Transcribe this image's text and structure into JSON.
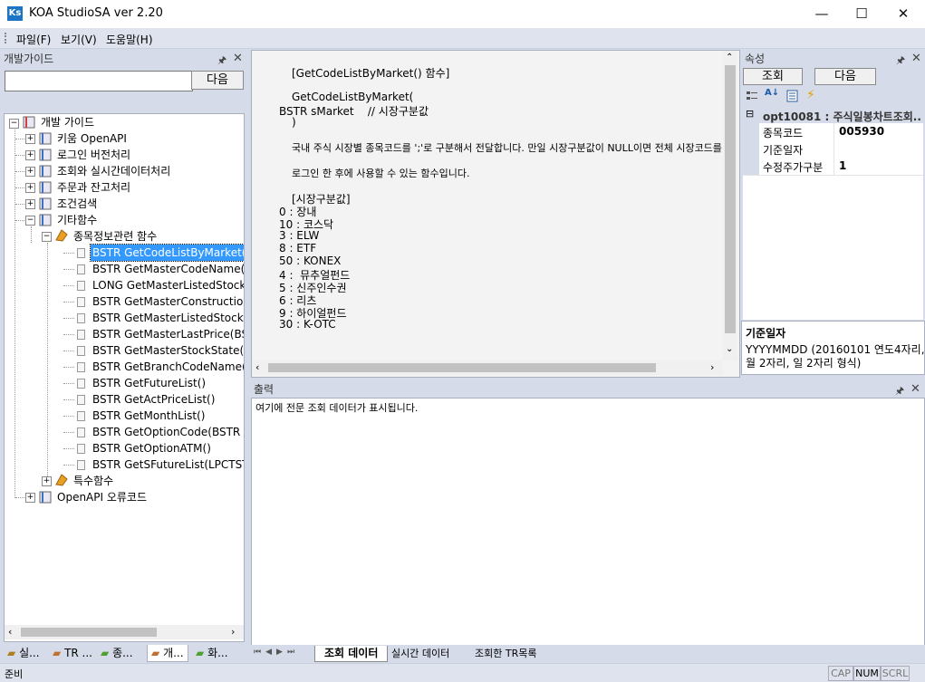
{
  "window": {
    "title": "KOA StudioSA ver 2.20",
    "icon_text": "Ks",
    "minimize": "—",
    "maximize": "☐",
    "close": "✕"
  },
  "menu": [
    "파일(F)",
    "보기(V)",
    "도움말(H)"
  ],
  "left_panel": {
    "title": "개발가이드",
    "search_placeholder": "",
    "next_button": "다음",
    "tree": {
      "root": "개발 가이드",
      "items": [
        "키움 OpenAPI",
        "로그인 버전처리",
        "조회와 실시간데이터처리",
        "주문과 잔고처리",
        "조건검색",
        "기타함수"
      ],
      "subgroup": "종목정보관련 함수",
      "functions": [
        "BSTR GetCodeListByMarket(BSTR",
        "BSTR GetMasterCodeName(BST",
        "LONG GetMasterListedStockCn",
        "BSTR GetMasterConstruction(B",
        "BSTR GetMasterListedStockDat",
        "BSTR GetMasterLastPrice(BSTR",
        "BSTR GetMasterStockState(BST",
        "BSTR GetBranchCodeName()",
        "BSTR GetFutureList()",
        "BSTR GetActPriceList()",
        "BSTR GetMonthList()",
        "BSTR GetOptionCode(BSTR str",
        "BSTR GetOptionATM()",
        "BSTR GetSFutureList(LPCTSTR s"
      ],
      "special": "특수함수",
      "errors": "OpenAPI 오류코드"
    },
    "tabs": [
      "실...",
      "TR ...",
      "종...",
      "개...",
      "화..."
    ]
  },
  "doc": {
    "heading": "[GetCodeListByMarket() 함수]",
    "sig1": "GetCodeListByMarket(",
    "sig2": "BSTR sMarket    // 시장구분값",
    "sig3": ")",
    "desc1": "국내 주식 시장별 종목코드를 ';'로 구분해서 전달합니다. 만일 시장구분값이 NULL이면 전체 시장코드를",
    "desc2": "로그인 한 후에 사용할 수 있는 함수입니다.",
    "list_title": "[시장구분값]",
    "list": [
      "0 : 장내",
      "10 : 코스닥",
      "3 : ELW",
      "8 : ETF",
      "50 : KONEX",
      "4 :  뮤추얼펀드",
      "5 : 신주인수권",
      "6 : 리츠",
      "9 : 하이얼펀드",
      "30 : K-OTC"
    ]
  },
  "props": {
    "title": "속성",
    "query_button": "조회",
    "next_button": "다음",
    "group": "opt10081 : 주식일봉차트조회...",
    "rows": [
      {
        "label": "종목코드",
        "value": "005930"
      },
      {
        "label": "기준일자",
        "value": ""
      },
      {
        "label": "수정주가구분",
        "value": "1"
      }
    ],
    "help_title": "기준일자",
    "help_text1": "YYYYMMDD (20160101 연도4자리,",
    "help_text2": "월 2자리, 일 2자리 형식)"
  },
  "output": {
    "title": "출력",
    "text": "여기에 전문 조회 데이터가 표시됩니다.",
    "tabs": [
      "조회 데이터",
      "실시간 데이터",
      "조회한 TR목록"
    ]
  },
  "status": {
    "left": "준비",
    "cap": "CAP",
    "num": "NUM",
    "scrl": "SCRL"
  }
}
